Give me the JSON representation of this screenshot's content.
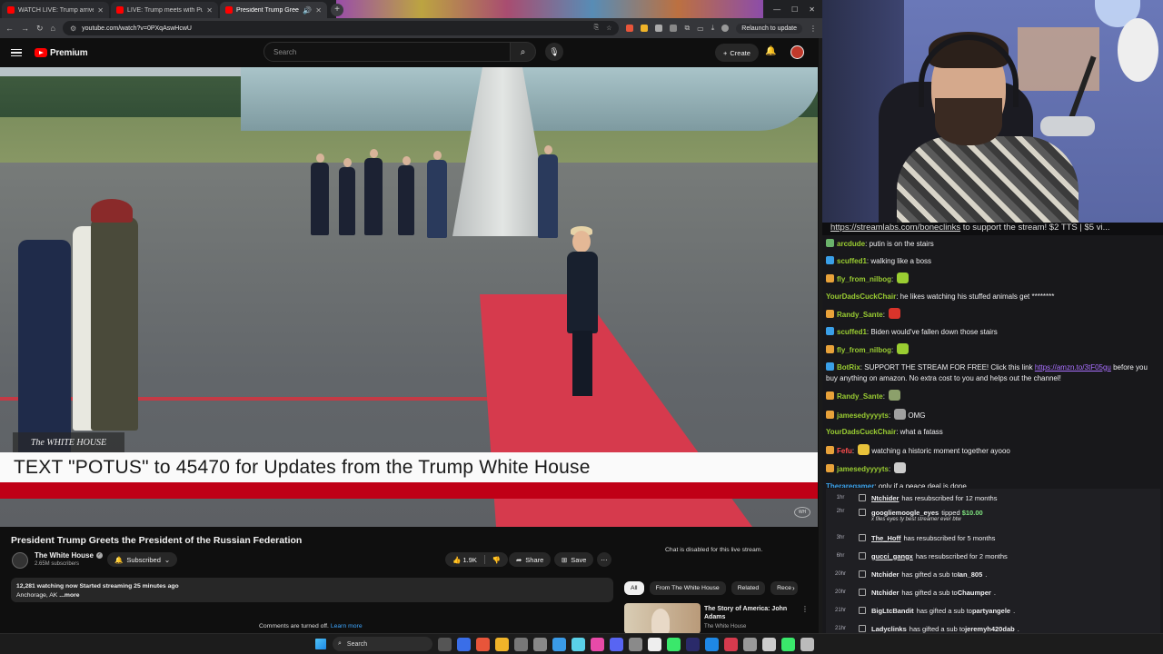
{
  "browser": {
    "tabs": [
      {
        "title": "WATCH LIVE: Trump arrives in ..."
      },
      {
        "title": "LIVE: Trump meets with Putin ..."
      },
      {
        "title": "President Trump Greets the ..."
      }
    ],
    "url": "youtube.com/watch?v=0PXqAswHcwU",
    "relaunch_label": "Relaunch to update"
  },
  "youtube": {
    "logo_text": "Premium",
    "search_placeholder": "Search",
    "create_label": "Create",
    "video_title": "President Trump Greets the President of the Russian Federation",
    "channel_name": "The White House",
    "channel_subs": "2.65M subscribers",
    "subscribed_label": "Subscribed",
    "like_count": "1.9K",
    "share_label": "Share",
    "save_label": "Save",
    "desc_stats": "12,281 watching now  Started streaming 25 minutes ago",
    "desc_location": "Anchorage, AK",
    "desc_more": "...more",
    "comments_off": "Comments are turned off.",
    "learn_more": "Learn more",
    "chat_disabled": "Chat is disabled for this live stream.",
    "chips": [
      "All",
      "From The White House",
      "Related",
      "Rece"
    ],
    "rec_title": "The Story of America: John Adams",
    "rec_channel": "The White House",
    "overlay_logo": "The WHITE HOUSE",
    "banner_text": "TEXT \"POTUS\" to 45470 for Updates from the Trump White House"
  },
  "ticker": {
    "link": "https://streamlabs.com/boneclinks",
    "rest": " to support the stream! $2 TTS | $5 vi..."
  },
  "chat": [
    {
      "user": "arcdude",
      "text": "putin is on the stairs",
      "color": "#9acd32",
      "badge": "#6bb36b"
    },
    {
      "user": "scuffed1",
      "text": "walking like a boss",
      "color": "#9acd32",
      "badge": "#3aa0e8"
    },
    {
      "user": "fly_from_nilbog",
      "text": "",
      "color": "#9acd32",
      "badge": "#e8a23a",
      "emote": "#9acd32"
    },
    {
      "user": "YourDadsCuckChair",
      "text": "he likes watching his stuffed animals get ********",
      "color": "#9acd32",
      "badge": ""
    },
    {
      "user": "Randy_Sante",
      "text": "",
      "color": "#9acd32",
      "badge": "#e8a23a",
      "emote": "#d9342b"
    },
    {
      "user": "scuffed1",
      "text": "Biden would've fallen down those stairs",
      "color": "#9acd32",
      "badge": "#3aa0e8"
    },
    {
      "user": "fly_from_nilbog",
      "text": "",
      "color": "#9acd32",
      "badge": "#e8a23a",
      "emote": "#9acd32"
    },
    {
      "user": "BotRix",
      "text": "SUPPORT THE STREAM FOR FREE! Click this link ",
      "link": "https://amzn.to/3tF05gu",
      "text2": " before you buy anything on amazon. No extra cost to you and helps out the channel!",
      "color": "#9acd32",
      "badge": "#3aa0e8"
    },
    {
      "user": "Randy_Sante",
      "text": "",
      "color": "#9acd32",
      "badge": "#e8a23a",
      "emote": "#8ca06b"
    },
    {
      "user": "jamesedyyyyts",
      "text": "OMG",
      "color": "#9acd32",
      "badge": "#e8a23a",
      "emote": "#a0a0a0"
    },
    {
      "user": "YourDadsCuckChair",
      "text": "what a fatass",
      "color": "#9acd32",
      "badge": ""
    },
    {
      "user": "Fefu",
      "text": "watching a historic moment together ayooo",
      "color": "#ff4e4e",
      "badge": "#e8a23a",
      "emote": "#e8c23a"
    },
    {
      "user": "jamesedyyyyts",
      "text": "",
      "color": "#9acd32",
      "badge": "#e8a23a",
      "emote": "#cccccc"
    },
    {
      "user": "Theraregamer",
      "text": "only if a peace deal is done",
      "color": "#3aa0e8",
      "badge": ""
    }
  ],
  "events": [
    {
      "time": "1hr",
      "name": "Ntchider",
      "underline": true,
      "text": "has resubscribed for 12 months"
    },
    {
      "time": "2hr",
      "name": "googliemoogle_eyes",
      "underline": false,
      "text": "tipped ",
      "amount": "$10.00",
      "note": "x files eyes ty best streamer ever btw"
    },
    {
      "time": "3hr",
      "name": "The_Hoff",
      "underline": true,
      "text": "has resubscribed for 5 months"
    },
    {
      "time": "6hr",
      "name": "gucci_gangx",
      "underline": true,
      "text": "has resubscribed for 2 months"
    },
    {
      "time": "20hr",
      "name": "Ntchider",
      "underline": false,
      "text": "has gifted a sub to ",
      "target": "Ian_805"
    },
    {
      "time": "20hr",
      "name": "Ntchider",
      "underline": false,
      "text": "has gifted a sub to ",
      "target": "Chaumper"
    },
    {
      "time": "21hr",
      "name": "BigLtcBandit",
      "underline": false,
      "text": "has gifted a sub to ",
      "target": "partyangele"
    },
    {
      "time": "21hr",
      "name": "Ladyclinks",
      "underline": false,
      "text": "has gifted a sub to ",
      "target": "jeremyh420dab"
    }
  ],
  "taskbar": {
    "search_label": "Search",
    "icon_colors": [
      "#555",
      "#3a6ee8",
      "#e8553a",
      "#f0b429",
      "#777",
      "#888",
      "#3a9be8",
      "#5ad1e8",
      "#e84aa8",
      "#5865f2",
      "#8a8a8a",
      "#eee",
      "#3ae86b",
      "#2a2a6a",
      "#1e88e5",
      "#d63a4d",
      "#999",
      "#ccc",
      "#3ae86b",
      "#bbb"
    ]
  }
}
